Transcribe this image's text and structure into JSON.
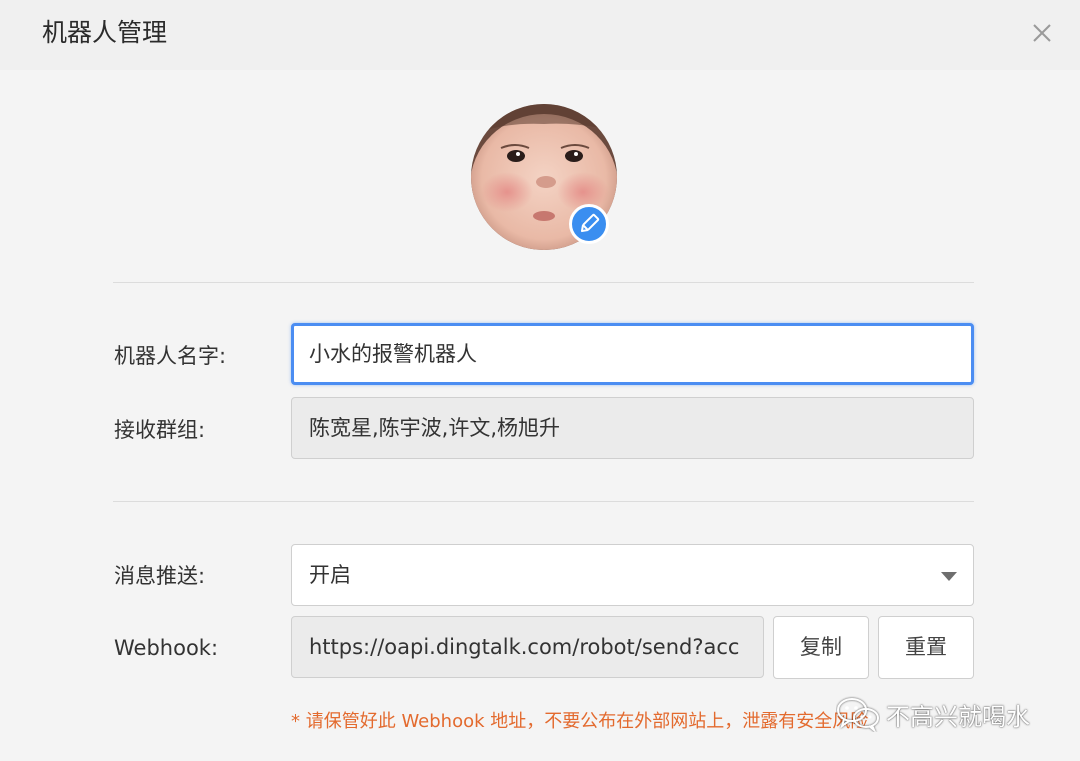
{
  "dialog": {
    "title": "机器人管理"
  },
  "avatar": {
    "alt": "robot-avatar"
  },
  "form": {
    "name_label": "机器人名字:",
    "name_value": "小水的报警机器人",
    "group_label": "接收群组:",
    "group_value": "陈宽星,陈宇波,许文,杨旭升",
    "push_label": "消息推送:",
    "push_value": "开启",
    "webhook_label": "Webhook:",
    "webhook_value": "https://oapi.dingtalk.com/robot/send?acc"
  },
  "buttons": {
    "copy": "复制",
    "reset": "重置"
  },
  "warning": "* 请保管好此 Webhook 地址，不要公布在外部网站上，泄露有安全风险",
  "watermark": {
    "text": "不高兴就喝水"
  },
  "colors": {
    "accent": "#4b8df2",
    "badge": "#3a8ef0",
    "warning": "#e36a2e"
  },
  "icons": {
    "close": "close-icon",
    "edit": "pencil-icon",
    "dropdown": "caret-down-icon",
    "watermark": "wechat-icon"
  }
}
